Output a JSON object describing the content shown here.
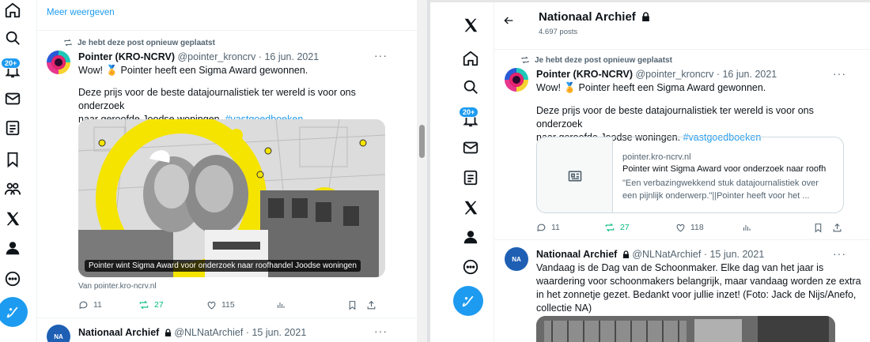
{
  "left": {
    "show_more": "Meer weergeven",
    "repost_note": "Je hebt deze post opnieuw geplaatst",
    "notif_badge": "20+",
    "post1": {
      "author": "Pointer (KRO-NCRV)",
      "handle": "@pointer_kroncrv",
      "date": "· 16 jun. 2021",
      "line1": "Wow! 🏅 Pointer heeft een Sigma Award gewonnen.",
      "line2a": "Deze prijs voor de beste datajournalistiek ter wereld is voor ons onderzoek",
      "line2b": "naar geroofde Joodse woningen.",
      "hashtag": "#vastgoedboeken",
      "image_caption": "Pointer wint Sigma Award voor onderzoek naar roofhandel Joodse woningen",
      "source": "Van pointer.kro-ncrv.nl",
      "replies": "11",
      "reposts": "27",
      "likes": "115"
    },
    "post2": {
      "author": "Nationaal Archief",
      "handle": "@NLNatArchief",
      "date": "· 15 jun. 2021"
    }
  },
  "right": {
    "header_title": "Nationaal Archief",
    "header_sub": "4.697 posts",
    "repost_note": "Je hebt deze post opnieuw geplaatst",
    "notif_badge": "20+",
    "post1": {
      "author": "Pointer (KRO-NCRV)",
      "handle": "@pointer_kroncrv",
      "date": "· 16 jun. 2021",
      "line1": "Wow! 🏅 Pointer heeft een Sigma Award gewonnen.",
      "line2a": "Deze prijs voor de beste datajournalistiek ter wereld is voor ons onderzoek",
      "line2b": "naar geroofde Joodse woningen.",
      "hashtag": "#vastgoedboeken",
      "card_domain": "pointer.kro-ncrv.nl",
      "card_title": "Pointer wint Sigma Award voor onderzoek naar roofh",
      "card_desc1": "\"Een verbazingwekkend stuk datajournalistiek over",
      "card_desc2": "een pijnlijk onderwerp.\"||Pointer heeft voor het ...",
      "replies": "11",
      "reposts": "27",
      "likes": "118"
    },
    "post2": {
      "author": "Nationaal Archief",
      "handle": "@NLNatArchief",
      "date": "· 15 jun. 2021",
      "text1": "Vandaag is de Dag van de Schoonmaker. Elke dag van het jaar is",
      "text2": "waardering voor schoonmakers belangrijk, maar vandaag worden ze extra",
      "text3": "in het zonnetje gezet. Bedankt voor jullie inzet! (Foto: Jack de Nijs/Anefo,",
      "text4": "collectie NA)"
    }
  },
  "colors": {
    "accent": "#1d9bf0",
    "repost_green": "#00ba7c",
    "muted": "#536471",
    "border": "#eff3f4"
  }
}
